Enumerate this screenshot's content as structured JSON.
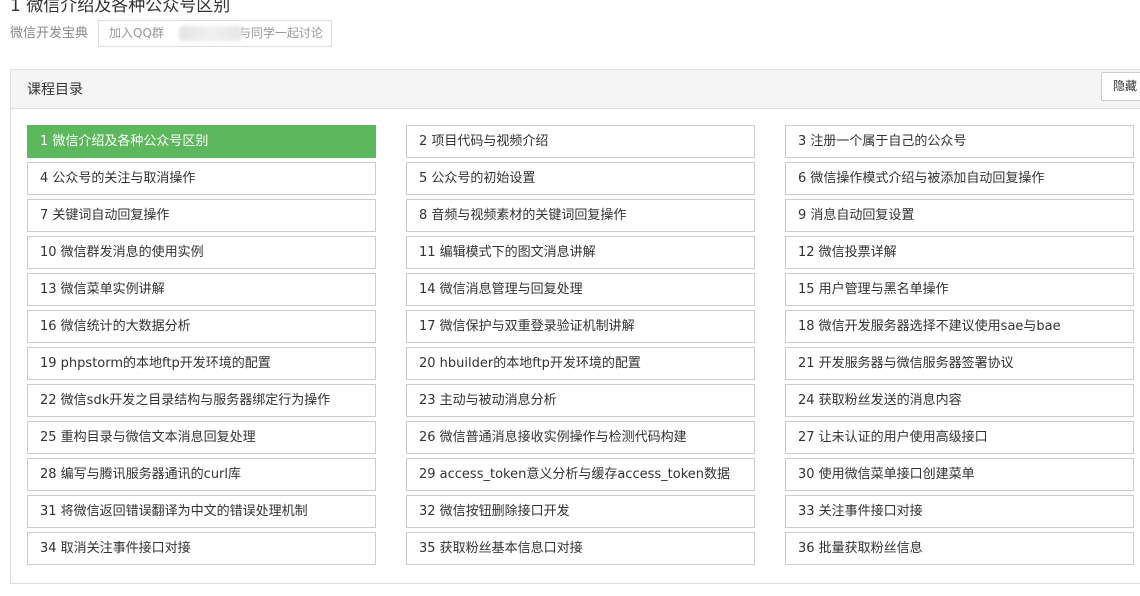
{
  "page": {
    "title": "1 微信介绍及各种公众号区别",
    "course_name": "微信开发宝典",
    "qq_prefix": "加入QQ群",
    "qq_suffix": "与同学一起讨论"
  },
  "catalog": {
    "title": "课程目录",
    "hide_label": "隐藏",
    "active_index": 0,
    "accent_color": "#5cb85c",
    "chapters": [
      "1 微信介绍及各种公众号区别",
      "2 项目代码与视频介绍",
      "3 注册一个属于自己的公众号",
      "4 公众号的关注与取消操作",
      "5 公众号的初始设置",
      "6 微信操作模式介绍与被添加自动回复操作",
      "7 关键词自动回复操作",
      "8 音频与视频素材的关键词回复操作",
      "9 消息自动回复设置",
      "10 微信群发消息的使用实例",
      "11 编辑模式下的图文消息讲解",
      "12 微信投票详解",
      "13 微信菜单实例讲解",
      "14 微信消息管理与回复处理",
      "15 用户管理与黑名单操作",
      "16 微信统计的大数据分析",
      "17 微信保护与双重登录验证机制讲解",
      "18 微信开发服务器选择不建议使用sae与bae",
      "19 phpstorm的本地ftp开发环境的配置",
      "20 hbuilder的本地ftp开发环境的配置",
      "21 开发服务器与微信服务器签署协议",
      "22 微信sdk开发之目录结构与服务器绑定行为操作",
      "23 主动与被动消息分析",
      "24 获取粉丝发送的消息内容",
      "25 重构目录与微信文本消息回复处理",
      "26 微信普通消息接收实例操作与检测代码构建",
      "27 让未认证的用户使用高级接口",
      "28 编写与腾讯服务器通讯的curl库",
      "29 access_token意义分析与缓存access_token数据",
      "30 使用微信菜单接口创建菜单",
      "31 将微信返回错误翻译为中文的错误处理机制",
      "32 微信按钮删除接口开发",
      "33 关注事件接口对接",
      "34 取消关注事件接口对接",
      "35 获取粉丝基本信息口对接",
      "36 批量获取粉丝信息"
    ]
  }
}
